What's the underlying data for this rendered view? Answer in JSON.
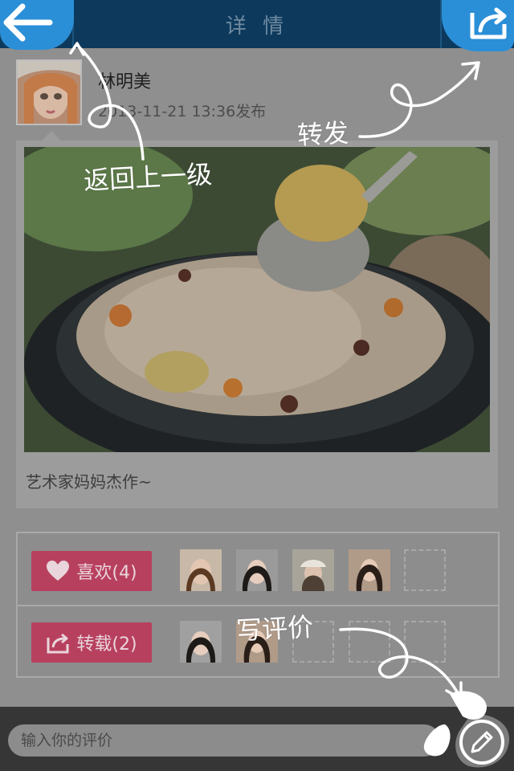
{
  "header": {
    "title": "详 情"
  },
  "user": {
    "name": "林明美",
    "post_time": "2013-11-21 13:36发布"
  },
  "post": {
    "caption": "艺术家妈妈杰作~"
  },
  "actions": {
    "like_label": "喜欢(4)",
    "repost_label": "转载(2)"
  },
  "comment": {
    "placeholder": "输入你的评价"
  },
  "hints": {
    "back": "返回上一级",
    "share": "转发",
    "write": "写评价"
  },
  "colors": {
    "header": "#0d3a5c",
    "accent_blue": "#2b8fd8",
    "action_pink": "#b8405f",
    "overlay_gray": "#8f8f8f"
  }
}
